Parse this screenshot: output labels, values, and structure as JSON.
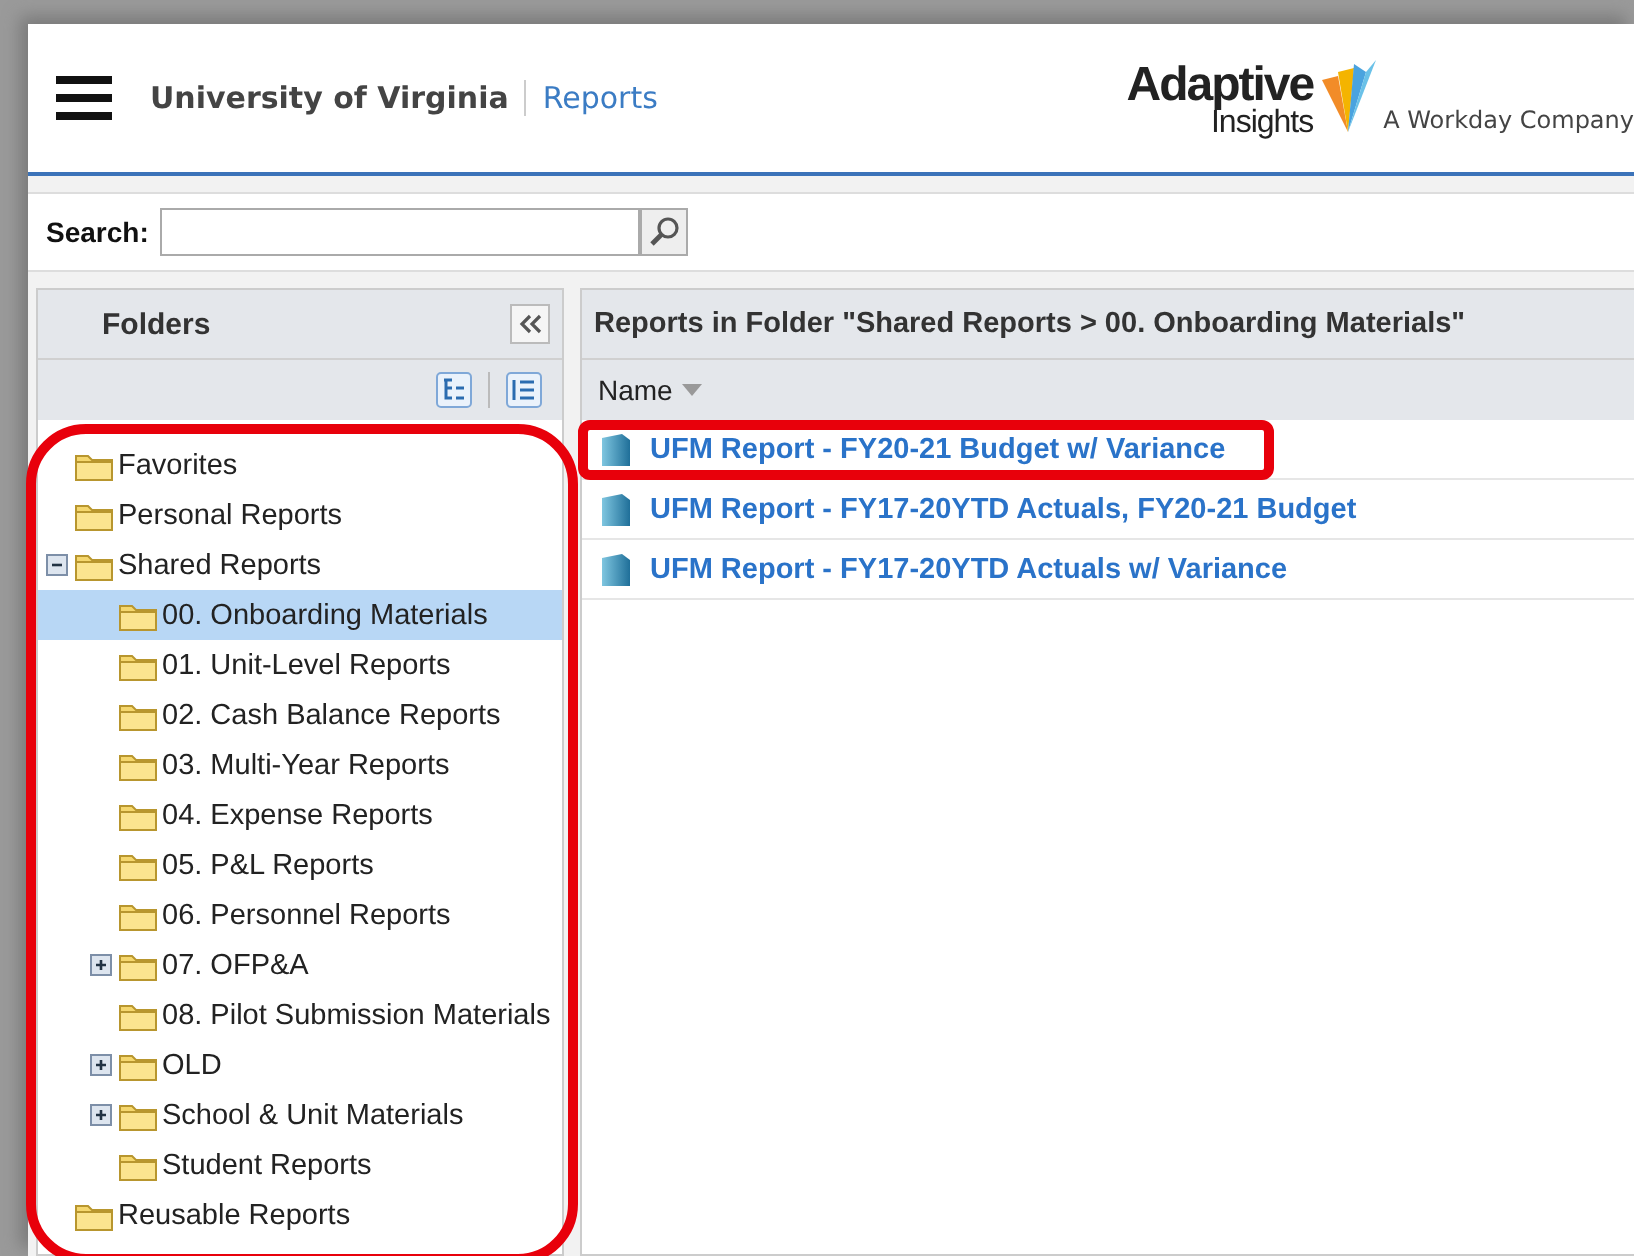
{
  "header": {
    "org": "University of Virginia",
    "section": "Reports",
    "logo_word": "Adaptive",
    "logo_sub": "Insights",
    "logo_tag": "A Workday Company"
  },
  "search": {
    "label": "Search:"
  },
  "folders": {
    "title": "Folders",
    "highlighted": true,
    "tree": [
      {
        "label": "Favorites",
        "selected": false
      },
      {
        "label": "Personal Reports",
        "selected": false
      },
      {
        "label": "Shared Reports",
        "selected": false,
        "expanded": true,
        "children": [
          {
            "label": "00. Onboarding Materials",
            "selected": true
          },
          {
            "label": "01. Unit-Level Reports",
            "selected": false
          },
          {
            "label": "02. Cash Balance Reports",
            "selected": false
          },
          {
            "label": "03. Multi-Year Reports",
            "selected": false
          },
          {
            "label": "04. Expense Reports",
            "selected": false
          },
          {
            "label": "05. P&L Reports",
            "selected": false
          },
          {
            "label": "06. Personnel Reports",
            "selected": false
          },
          {
            "label": "07. OFP&A",
            "selected": false,
            "expanded": false
          },
          {
            "label": "08. Pilot Submission Materials",
            "selected": false
          },
          {
            "label": "OLD",
            "selected": false,
            "expanded": false
          },
          {
            "label": "School & Unit Materials",
            "selected": false,
            "expanded": false
          },
          {
            "label": "Student Reports",
            "selected": false
          }
        ]
      },
      {
        "label": "Reusable Reports",
        "selected": false
      }
    ]
  },
  "reports": {
    "title": "Reports in Folder \"Shared Reports > 00. Onboarding Materials\"",
    "column": "Name",
    "rows": [
      {
        "name": "UFM Report - FY20-21 Budget w/ Variance",
        "highlighted": true
      },
      {
        "name": "UFM Report - FY17-20YTD Actuals, FY20-21 Budget",
        "highlighted": false
      },
      {
        "name": "UFM Report - FY17-20YTD Actuals w/ Variance",
        "highlighted": false
      }
    ]
  }
}
